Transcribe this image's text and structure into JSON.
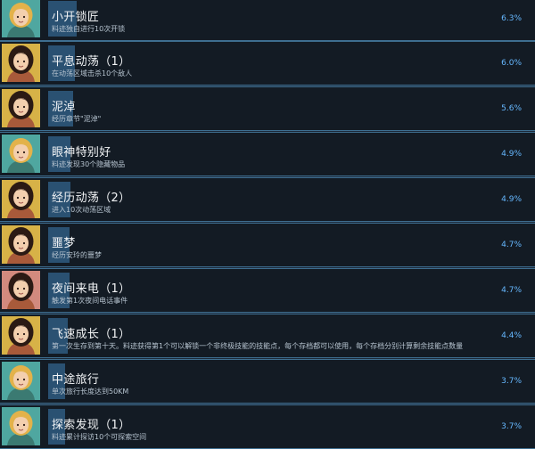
{
  "achievements": [
    {
      "title": "小开锁匠",
      "desc": "料迹独自进行10次开锁",
      "percent": "6.3%",
      "rate": 6.3,
      "avatar": "blonde-girl-avatar",
      "bg": "#4fa7a0"
    },
    {
      "title": "平息动荡（1）",
      "desc": "在动荡区域击杀10个敌人",
      "percent": "6.0%",
      "rate": 6.0,
      "avatar": "dark-hair-girl-avatar",
      "bg": "#d7b247"
    },
    {
      "title": "泥淖",
      "desc": "经历章节\"泥淖\"",
      "percent": "5.6%",
      "rate": 5.6,
      "avatar": "dark-hair-girl-avatar",
      "bg": "#d7b247"
    },
    {
      "title": "眼神特别好",
      "desc": "料迹发现30个隐藏物品",
      "percent": "4.9%",
      "rate": 4.9,
      "avatar": "blonde-girl-avatar",
      "bg": "#4fa7a0"
    },
    {
      "title": "经历动荡（2）",
      "desc": "进入10次动荡区域",
      "percent": "4.9%",
      "rate": 4.9,
      "avatar": "dark-hair-girl-avatar",
      "bg": "#d7b247"
    },
    {
      "title": "噩梦",
      "desc": "经历安玲的噩梦",
      "percent": "4.7%",
      "rate": 4.7,
      "avatar": "dark-hair-girl-avatar",
      "bg": "#d7b247"
    },
    {
      "title": "夜间来电（1）",
      "desc": "触发第1次夜间电话事件",
      "percent": "4.7%",
      "rate": 4.7,
      "avatar": "dark-hair-girl-avatar",
      "bg": "#d28a7e"
    },
    {
      "title": "飞速成长（1）",
      "desc": "第一次生存到第十天。料迹获得第1个可以解锁一个非终极技能的技能点，每个存档都可以使用，每个存档分别计算剩余技能点数量",
      "percent": "4.4%",
      "rate": 4.4,
      "avatar": "dark-hair-girl-avatar",
      "bg": "#d7b247"
    },
    {
      "title": "中途旅行",
      "desc": "单次旅行长度达到50KM",
      "percent": "3.7%",
      "rate": 3.7,
      "avatar": "blonde-girl-avatar",
      "bg": "#4fa7a0"
    },
    {
      "title": "探索发现（1）",
      "desc": "料迹累计探访10个可探索空间",
      "percent": "3.7%",
      "rate": 3.7,
      "avatar": "blonde-girl-avatar",
      "bg": "#4fa7a0"
    }
  ]
}
